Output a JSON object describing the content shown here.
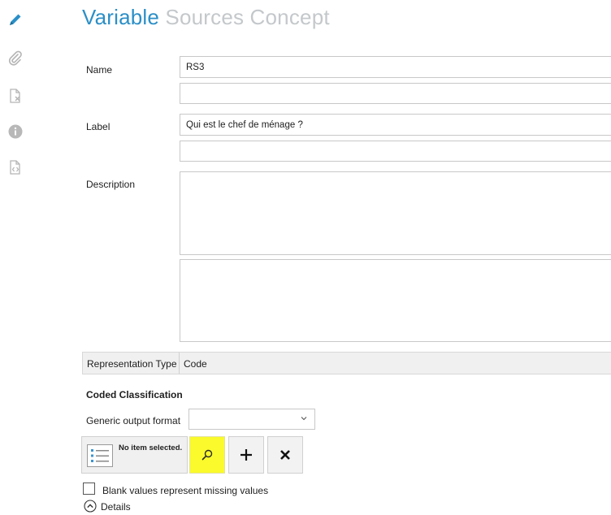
{
  "sidebar": {
    "items": [
      {
        "icon": "pencil-icon",
        "active": true
      },
      {
        "icon": "paperclip-icon"
      },
      {
        "icon": "document-remove-icon"
      },
      {
        "icon": "info-icon"
      },
      {
        "icon": "code-file-icon"
      }
    ]
  },
  "tabs": [
    {
      "label": "Variable",
      "active": true
    },
    {
      "label": "Sources"
    },
    {
      "label": "Concept"
    }
  ],
  "form": {
    "name_label": "Name",
    "name_value": "RS3",
    "name_value_2": "",
    "label_label": "Label",
    "label_value": "Qui est le chef de ménage ?",
    "label_value_2": "",
    "description_label": "Description",
    "description_value": "",
    "description_value_2": "",
    "representation_type_label": "Representation Type",
    "representation_type_value": "Code"
  },
  "coded_classification": {
    "heading": "Coded Classification",
    "generic_output_format_label": "Generic output format",
    "generic_output_format_value": "",
    "item_selection": "No item selected.",
    "blank_values_label": "Blank values represent missing values",
    "blank_values_checked": false,
    "details_label": "Details"
  },
  "colors": {
    "accent": "#2b8fc7",
    "tab_inactive": "#c4c8cb",
    "highlight": "#fafa2c"
  }
}
